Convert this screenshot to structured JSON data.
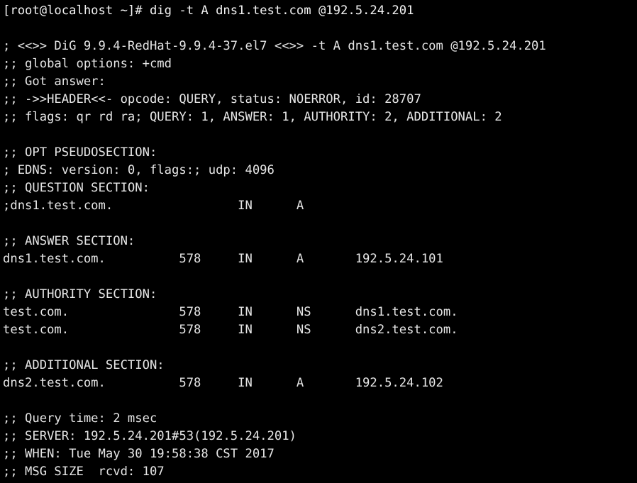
{
  "terminal": {
    "app": "terminal-console",
    "background_color": "#000000",
    "foreground_color": "#e6e6e6",
    "prompt": {
      "user": "root",
      "host": "localhost",
      "cwd": "~",
      "symbol": "#",
      "full_prompt": "[root@localhost ~]#",
      "command": "dig -t A dns1.test.com @192.5.24.201",
      "full_line": "[root@localhost ~]# dig -t A dns1.test.com @192.5.24.201"
    },
    "lines": [
      "[root@localhost ~]# dig -t A dns1.test.com @192.5.24.201",
      "",
      "; <<>> DiG 9.9.4-RedHat-9.9.4-37.el7 <<>> -t A dns1.test.com @192.5.24.201",
      ";; global options: +cmd",
      ";; Got answer:",
      ";; ->>HEADER<<- opcode: QUERY, status: NOERROR, id: 28707",
      ";; flags: qr rd ra; QUERY: 1, ANSWER: 1, AUTHORITY: 2, ADDITIONAL: 2",
      "",
      ";; OPT PSEUDOSECTION:",
      "; EDNS: version: 0, flags:; udp: 4096",
      ";; QUESTION SECTION:",
      ";dns1.test.com.                 IN      A",
      "",
      ";; ANSWER SECTION:",
      "dns1.test.com.          578     IN      A       192.5.24.101",
      "",
      ";; AUTHORITY SECTION:",
      "test.com.               578     IN      NS      dns1.test.com.",
      "test.com.               578     IN      NS      dns2.test.com.",
      "",
      ";; ADDITIONAL SECTION:",
      "dns2.test.com.          578     IN      A       192.5.24.102",
      "",
      ";; Query time: 2 msec",
      ";; SERVER: 192.5.24.201#53(192.5.24.201)",
      ";; WHEN: Tue May 30 19:58:38 CST 2017",
      ";; MSG SIZE  rcvd: 107"
    ],
    "dig_output": {
      "version_banner": "; <<>> DiG 9.9.4-RedHat-9.9.4-37.el7 <<>> -t A dns1.test.com @192.5.24.201",
      "dig_version": "9.9.4-RedHat-9.9.4-37.el7",
      "global_options": ";; global options: +cmd",
      "got_answer": ";; Got answer:",
      "header": {
        "line": ";; ->>HEADER<<- opcode: QUERY, status: NOERROR, id: 28707",
        "opcode": "QUERY",
        "status": "NOERROR",
        "id": "28707"
      },
      "flags": {
        "line": ";; flags: qr rd ra; QUERY: 1, ANSWER: 1, AUTHORITY: 2, ADDITIONAL: 2",
        "flags": "qr rd ra",
        "query": "1",
        "answer": "1",
        "authority": "2",
        "additional": "2"
      },
      "opt_pseudosection": {
        "header": ";; OPT PSEUDOSECTION:",
        "edns": "; EDNS: version: 0, flags:; udp: 4096",
        "version": "0",
        "udp": "4096"
      },
      "question_section": {
        "header": ";; QUESTION SECTION:",
        "rows": [
          {
            "name": ";dns1.test.com.",
            "class": "IN",
            "type": "A"
          }
        ]
      },
      "answer_section": {
        "header": ";; ANSWER SECTION:",
        "rows": [
          {
            "name": "dns1.test.com.",
            "ttl": "578",
            "class": "IN",
            "type": "A",
            "data": "192.5.24.101"
          }
        ]
      },
      "authority_section": {
        "header": ";; AUTHORITY SECTION:",
        "rows": [
          {
            "name": "test.com.",
            "ttl": "578",
            "class": "IN",
            "type": "NS",
            "data": "dns1.test.com."
          },
          {
            "name": "test.com.",
            "ttl": "578",
            "class": "IN",
            "type": "NS",
            "data": "dns2.test.com."
          }
        ]
      },
      "additional_section": {
        "header": ";; ADDITIONAL SECTION:",
        "rows": [
          {
            "name": "dns2.test.com.",
            "ttl": "578",
            "class": "IN",
            "type": "A",
            "data": "192.5.24.102"
          }
        ]
      },
      "stats": {
        "query_time": ";; Query time: 2 msec",
        "server": ";; SERVER: 192.5.24.201#53(192.5.24.201)",
        "when": ";; WHEN: Tue May 30 19:58:38 CST 2017",
        "msg_size": ";; MSG SIZE  rcvd: 107",
        "query_time_value": "2 msec",
        "server_value": "192.5.24.201#53(192.5.24.201)",
        "when_value": "Tue May 30 19:58:38 CST 2017",
        "msg_size_value": "107"
      }
    }
  }
}
